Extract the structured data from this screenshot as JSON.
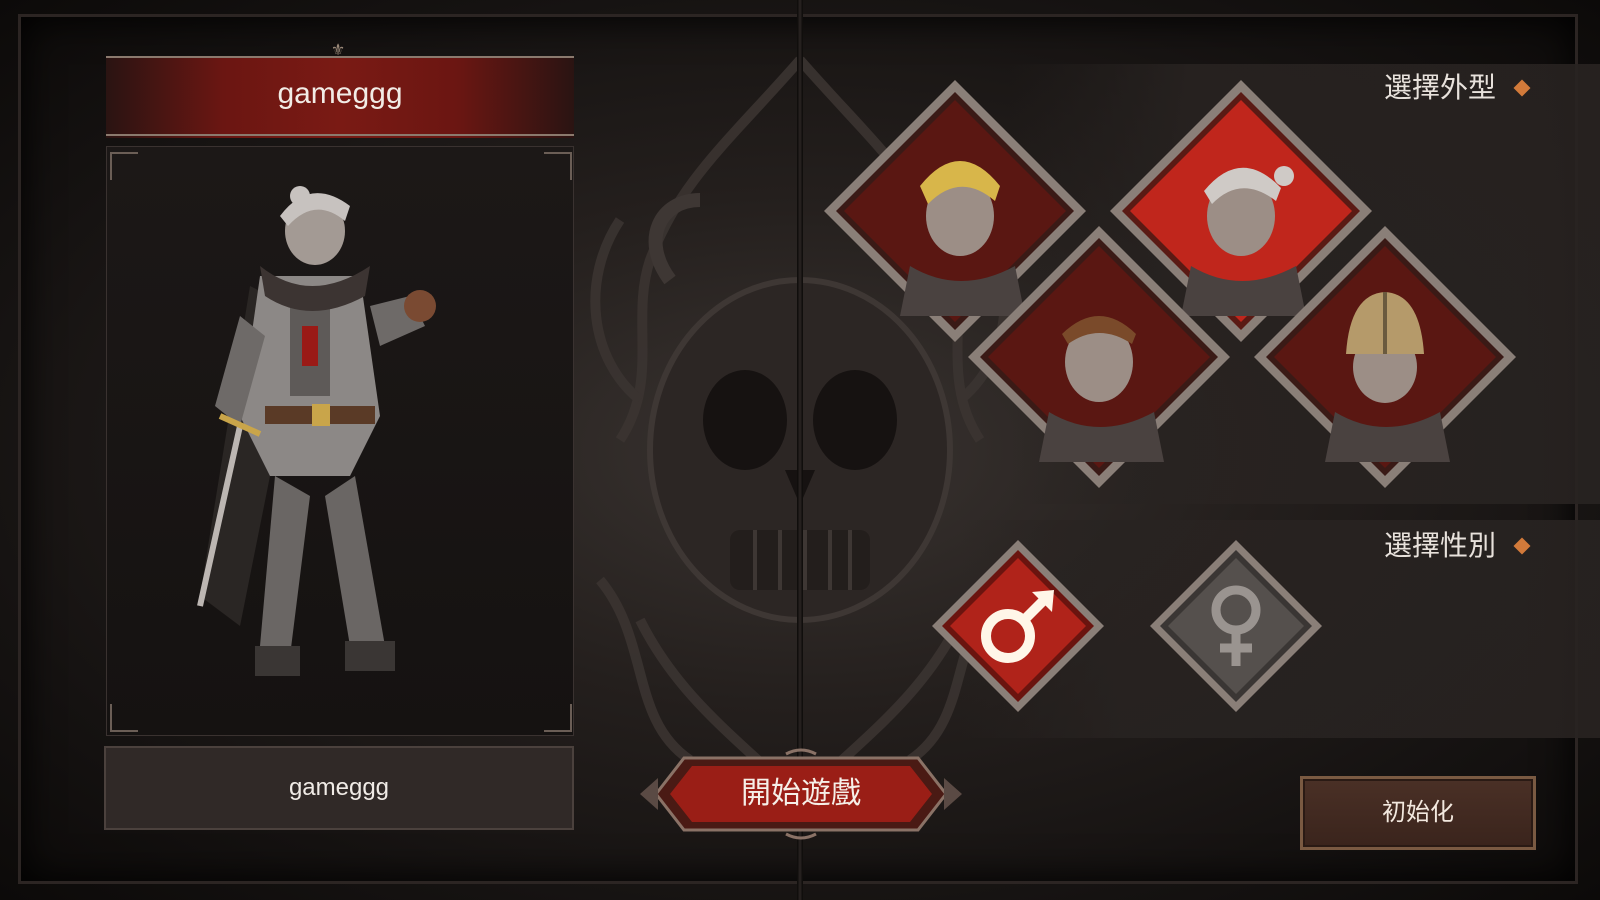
{
  "player": {
    "name_banner": "gameggg",
    "name_field_value": "gameggg"
  },
  "appearance": {
    "title": "選擇外型",
    "options": [
      {
        "id": "blonde",
        "icon": "blonde-hair-portrait-icon",
        "selected": false
      },
      {
        "id": "silver-topknot",
        "icon": "silver-topknot-portrait-icon",
        "selected": true
      },
      {
        "id": "brown-short",
        "icon": "brown-short-hair-portrait-icon",
        "selected": false
      },
      {
        "id": "helmeted",
        "icon": "helmeted-portrait-icon",
        "selected": false
      }
    ]
  },
  "gender": {
    "title": "選擇性別",
    "options": [
      {
        "id": "male",
        "symbol": "♂",
        "icon": "male-symbol-icon",
        "selected": true
      },
      {
        "id": "female",
        "symbol": "♀",
        "icon": "female-symbol-icon",
        "selected": false
      }
    ]
  },
  "actions": {
    "start_label": "開始遊戲",
    "reset_label": "初始化"
  },
  "colors": {
    "accent_red": "#8e1a14",
    "selected_red": "#c0261c",
    "diamond_orange": "#d27a3a",
    "text": "#f2ece6"
  }
}
